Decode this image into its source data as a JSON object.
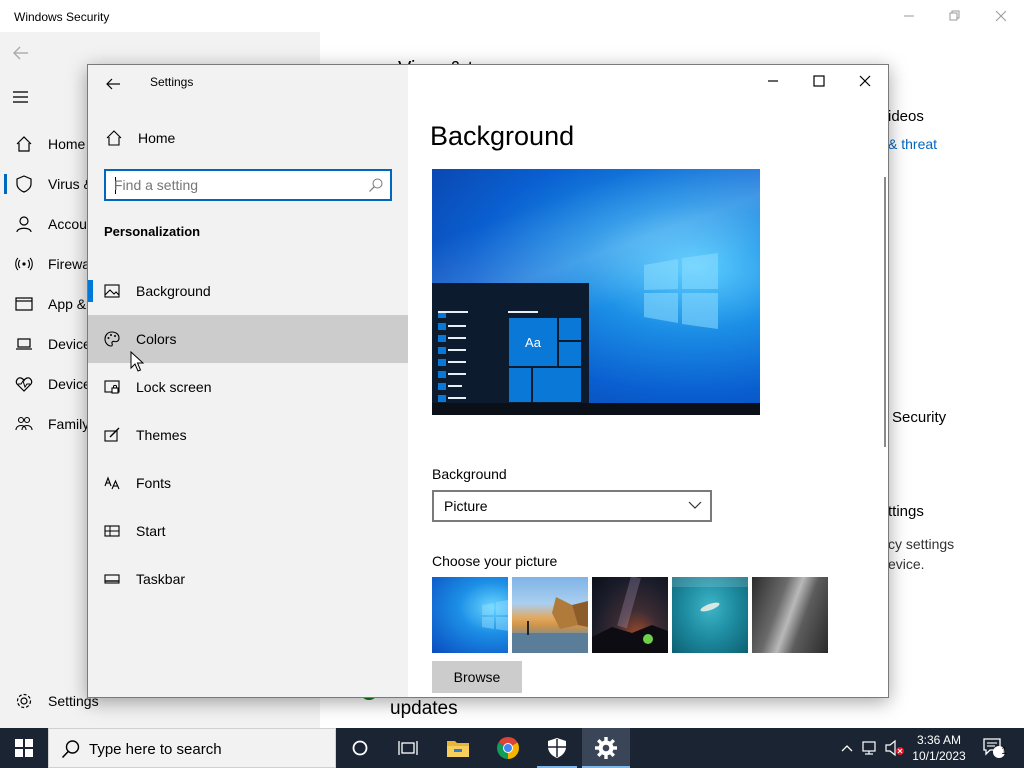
{
  "windows_security": {
    "title": "Windows Security",
    "nav_items": [
      {
        "label": "Home",
        "icon": "home-icon"
      },
      {
        "label": "Virus &",
        "icon": "shield-icon"
      },
      {
        "label": "Accou",
        "icon": "person-icon"
      },
      {
        "label": "Firewa",
        "icon": "antenna-icon"
      },
      {
        "label": "App &",
        "icon": "app-browser-icon"
      },
      {
        "label": "Device",
        "icon": "laptop-icon"
      },
      {
        "label": "Device",
        "icon": "heart-icon"
      },
      {
        "label": "Family",
        "icon": "family-icon"
      }
    ],
    "settings_label": "Settings",
    "content_fragments": {
      "videos": "ideos",
      "threat_link": "& threat",
      "security": "Security",
      "settings_heading": "ttings",
      "privacy_line1": "cy settings",
      "privacy_line2": "evice.",
      "updates": "updates",
      "partial_heading": "Virus & t"
    }
  },
  "settings_window": {
    "title": "Settings",
    "home_label": "Home",
    "search_placeholder": "Find a setting",
    "section_title": "Personalization",
    "nav_items": [
      {
        "label": "Background",
        "icon": "image-icon",
        "active": true
      },
      {
        "label": "Colors",
        "icon": "palette-icon",
        "hover": true
      },
      {
        "label": "Lock screen",
        "icon": "lock-screen-icon"
      },
      {
        "label": "Themes",
        "icon": "brush-icon"
      },
      {
        "label": "Fonts",
        "icon": "fonts-icon"
      },
      {
        "label": "Start",
        "icon": "start-menu-icon"
      },
      {
        "label": "Taskbar",
        "icon": "taskbar-icon"
      }
    ],
    "page_heading": "Background",
    "preview_tile_text": "Aa",
    "background_label": "Background",
    "background_value": "Picture",
    "choose_picture_label": "Choose your picture",
    "browse_label": "Browse"
  },
  "taskbar": {
    "search_placeholder": "Type here to search",
    "time": "3:36 AM",
    "date": "10/1/2023",
    "notification_count": "1",
    "apps": [
      "cortana-icon",
      "task-view-icon",
      "file-explorer-icon",
      "chrome-icon",
      "windows-security-icon",
      "settings-gear-icon"
    ]
  },
  "colors": {
    "accent": "#0078d7",
    "taskbar": "#1a2433",
    "nav_bg": "#f2f2f2",
    "hover": "#cccccc"
  }
}
